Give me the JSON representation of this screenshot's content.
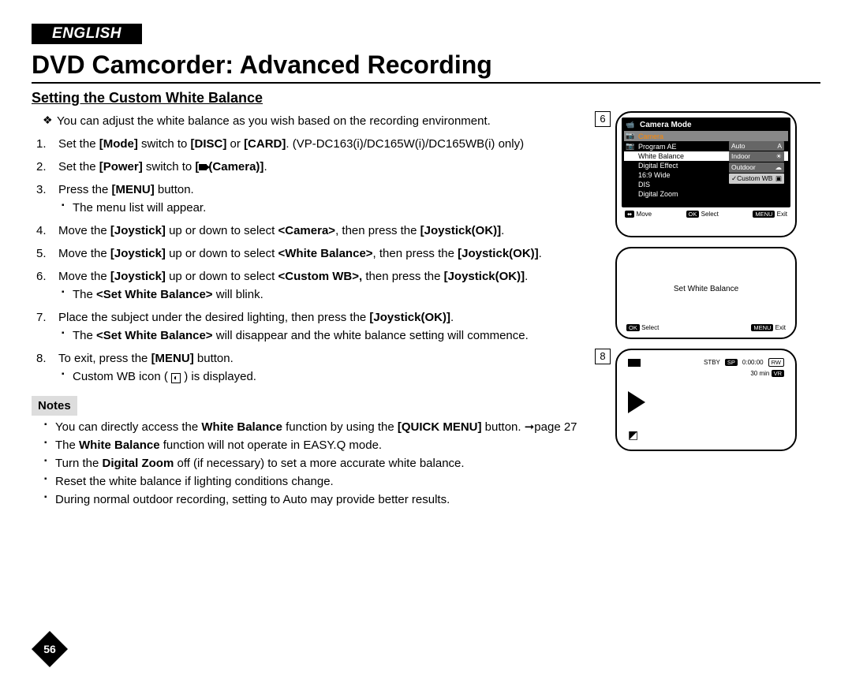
{
  "language_tag": "ENGLISH",
  "page_title": "DVD Camcorder: Advanced Recording",
  "subtitle": "Setting the Custom White Balance",
  "intro": "You can adjust the white balance as you wish based on the recording environment.",
  "steps": [
    {
      "text": "Set the <b>[Mode]</b> switch to <b>[DISC]</b> or <b>[CARD]</b>. (VP-DC163(i)/DC165W(i)/DC165WB(i) only)"
    },
    {
      "text": "Set the <b>[Power]</b> switch to <b>[<span class='cam-icon'></span>(Camera)]</b>."
    },
    {
      "text": "Press the <b>[MENU]</b> button.",
      "subs": [
        "The menu list will appear."
      ]
    },
    {
      "text": "Move the <b>[Joystick]</b> up or down to select <b>&lt;Camera&gt;</b>, then press the <b>[Joystick(OK)]</b>."
    },
    {
      "text": "Move the <b>[Joystick]</b> up or down to select <b>&lt;White Balance&gt;</b>, then press the <b>[Joystick(OK)]</b>."
    },
    {
      "text": "Move the <b>[Joystick]</b> up or down to select <b>&lt;Custom WB&gt;,</b> then press the <b>[Joystick(OK)]</b>.",
      "subs": [
        "The <b>&lt;Set White Balance&gt;</b> will blink."
      ]
    },
    {
      "text": "Place the subject under the desired lighting, then press the <b>[Joystick(OK)]</b>.",
      "subs": [
        "The <b>&lt;Set White Balance&gt;</b> will disappear and the white balance setting will commence."
      ]
    },
    {
      "text": "To exit, press the <b>[MENU]</b> button.",
      "subs": [
        "Custom WB icon ( <span style='border:1px solid #000;padding:0 2px;font-size:10px'>&#9680;</span> ) is displayed."
      ]
    }
  ],
  "notes_label": "Notes",
  "notes": [
    "You can directly access the <b>White Balance</b> function by using the <b>[QUICK MENU]</b> button. &#10142;page 27",
    "The <b>White Balance</b> function will not operate in EASY.Q mode.",
    "Turn the <b>Digital Zoom</b> off (if necessary) to set a more accurate white balance.",
    "Reset the white balance if lighting conditions change.",
    "During normal outdoor recording, setting to Auto may provide better results."
  ],
  "page_number": "56",
  "fig6": {
    "num": "6",
    "title": "Camera Mode",
    "active_cat": "Camera",
    "items": [
      "Program AE",
      "White Balance",
      "Digital Effect",
      "16:9 Wide",
      "DIS",
      "Digital Zoom"
    ],
    "selected_item": "White Balance",
    "options": [
      {
        "label": "Auto",
        "mark": "A"
      },
      {
        "label": "Indoor",
        "mark": "☀"
      },
      {
        "label": "Outdoor",
        "mark": "☁"
      },
      {
        "label": "Custom WB",
        "mark": "▣",
        "sel": true
      }
    ],
    "footer": {
      "move": "Move",
      "select": "Select",
      "exit": "Exit",
      "move_chip": "⬌",
      "ok_chip": "OK",
      "menu_chip": "MENU"
    }
  },
  "fig_mid": {
    "center_text": "Set White Balance",
    "footer": {
      "select": "Select",
      "exit": "Exit",
      "ok_chip": "OK",
      "menu_chip": "MENU"
    }
  },
  "fig8": {
    "num": "8",
    "status": {
      "stby": "STBY",
      "sp": "SP",
      "time": "0:00:00",
      "rw": "RW",
      "remain": "30 min",
      "vr": "VR"
    }
  }
}
